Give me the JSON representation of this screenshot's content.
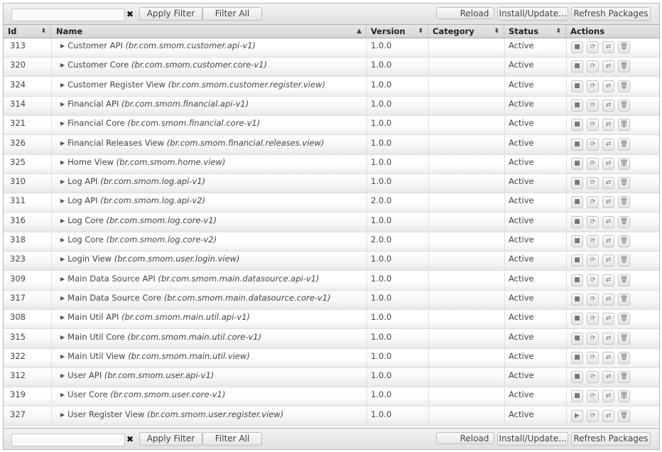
{
  "toolbar": {
    "filter_value": "",
    "clear_label": "✖",
    "apply_filter": "Apply Filter",
    "filter_all": "Filter All",
    "reload": "Reload",
    "install_update": "Install/Update...",
    "refresh_packages": "Refresh Packages"
  },
  "columns": {
    "id": "Id",
    "name": "Name",
    "version": "Version",
    "category": "Category",
    "status": "Status",
    "actions": "Actions"
  },
  "icons": {
    "sort_both": "⬍",
    "sort_asc": "▲",
    "expand": "▶",
    "stop": "■",
    "start": "▶",
    "refresh": "⟳",
    "update": "⇄",
    "uninstall": "🗑"
  },
  "bundles": [
    {
      "id": "313",
      "name": "Customer API",
      "symbolic": "(br.com.smom.customer.api-v1)",
      "version": "1.0.0",
      "category": "",
      "status": "Active",
      "state": "active"
    },
    {
      "id": "320",
      "name": "Customer Core",
      "symbolic": "(br.com.smom.customer.core-v1)",
      "version": "1.0.0",
      "category": "",
      "status": "Active",
      "state": "active"
    },
    {
      "id": "324",
      "name": "Customer Register View",
      "symbolic": "(br.com.smom.customer.register.view)",
      "version": "1.0.0",
      "category": "",
      "status": "Active",
      "state": "active"
    },
    {
      "id": "314",
      "name": "Financial API",
      "symbolic": "(br.com.smom.financial.api-v1)",
      "version": "1.0.0",
      "category": "",
      "status": "Active",
      "state": "active"
    },
    {
      "id": "321",
      "name": "Financial Core",
      "symbolic": "(br.com.smom.financial.core-v1)",
      "version": "1.0.0",
      "category": "",
      "status": "Active",
      "state": "active"
    },
    {
      "id": "326",
      "name": "Financial Releases View",
      "symbolic": "(br.com.smom.financial.releases.view)",
      "version": "1.0.0",
      "category": "",
      "status": "Active",
      "state": "active"
    },
    {
      "id": "325",
      "name": "Home View",
      "symbolic": "(br.com.smom.home.view)",
      "version": "1.0.0",
      "category": "",
      "status": "Active",
      "state": "active"
    },
    {
      "id": "310",
      "name": "Log API",
      "symbolic": "(br.com.smom.log.api-v1)",
      "version": "1.0.0",
      "category": "",
      "status": "Active",
      "state": "active"
    },
    {
      "id": "311",
      "name": "Log API",
      "symbolic": "(br.com.smom.log.api-v2)",
      "version": "2.0.0",
      "category": "",
      "status": "Active",
      "state": "active"
    },
    {
      "id": "316",
      "name": "Log Core",
      "symbolic": "(br.com.smom.log.core-v1)",
      "version": "1.0.0",
      "category": "",
      "status": "Active",
      "state": "active"
    },
    {
      "id": "318",
      "name": "Log Core",
      "symbolic": "(br.com.smom.log.core-v2)",
      "version": "2.0.0",
      "category": "",
      "status": "Active",
      "state": "active"
    },
    {
      "id": "323",
      "name": "Login View",
      "symbolic": "(br.com.smom.user.login.view)",
      "version": "1.0.0",
      "category": "",
      "status": "Active",
      "state": "active"
    },
    {
      "id": "309",
      "name": "Main Data Source API",
      "symbolic": "(br.com.smom.main.datasource.api-v1)",
      "version": "1.0.0",
      "category": "",
      "status": "Active",
      "state": "active"
    },
    {
      "id": "317",
      "name": "Main Data Source Core",
      "symbolic": "(br.com.smom.main.datasource.core-v1)",
      "version": "1.0.0",
      "category": "",
      "status": "Active",
      "state": "active"
    },
    {
      "id": "308",
      "name": "Main Util API",
      "symbolic": "(br.com.smom.main.util.api-v1)",
      "version": "1.0.0",
      "category": "",
      "status": "Active",
      "state": "active"
    },
    {
      "id": "315",
      "name": "Main Util Core",
      "symbolic": "(br.com.smom.main.util.core-v1)",
      "version": "1.0.0",
      "category": "",
      "status": "Active",
      "state": "active"
    },
    {
      "id": "322",
      "name": "Main Util View",
      "symbolic": "(br.com.smom.main.util.view)",
      "version": "1.0.0",
      "category": "",
      "status": "Active",
      "state": "active"
    },
    {
      "id": "312",
      "name": "User API",
      "symbolic": "(br.com.smom.user.api-v1)",
      "version": "1.0.0",
      "category": "",
      "status": "Active",
      "state": "active"
    },
    {
      "id": "319",
      "name": "User Core",
      "symbolic": "(br.com.smom.user.core-v1)",
      "version": "1.0.0",
      "category": "",
      "status": "Active",
      "state": "active"
    },
    {
      "id": "327",
      "name": "User Register View",
      "symbolic": "(br.com.smom.user.register.view)",
      "version": "1.0.0",
      "category": "",
      "status": "Active",
      "state": "resolved"
    }
  ]
}
